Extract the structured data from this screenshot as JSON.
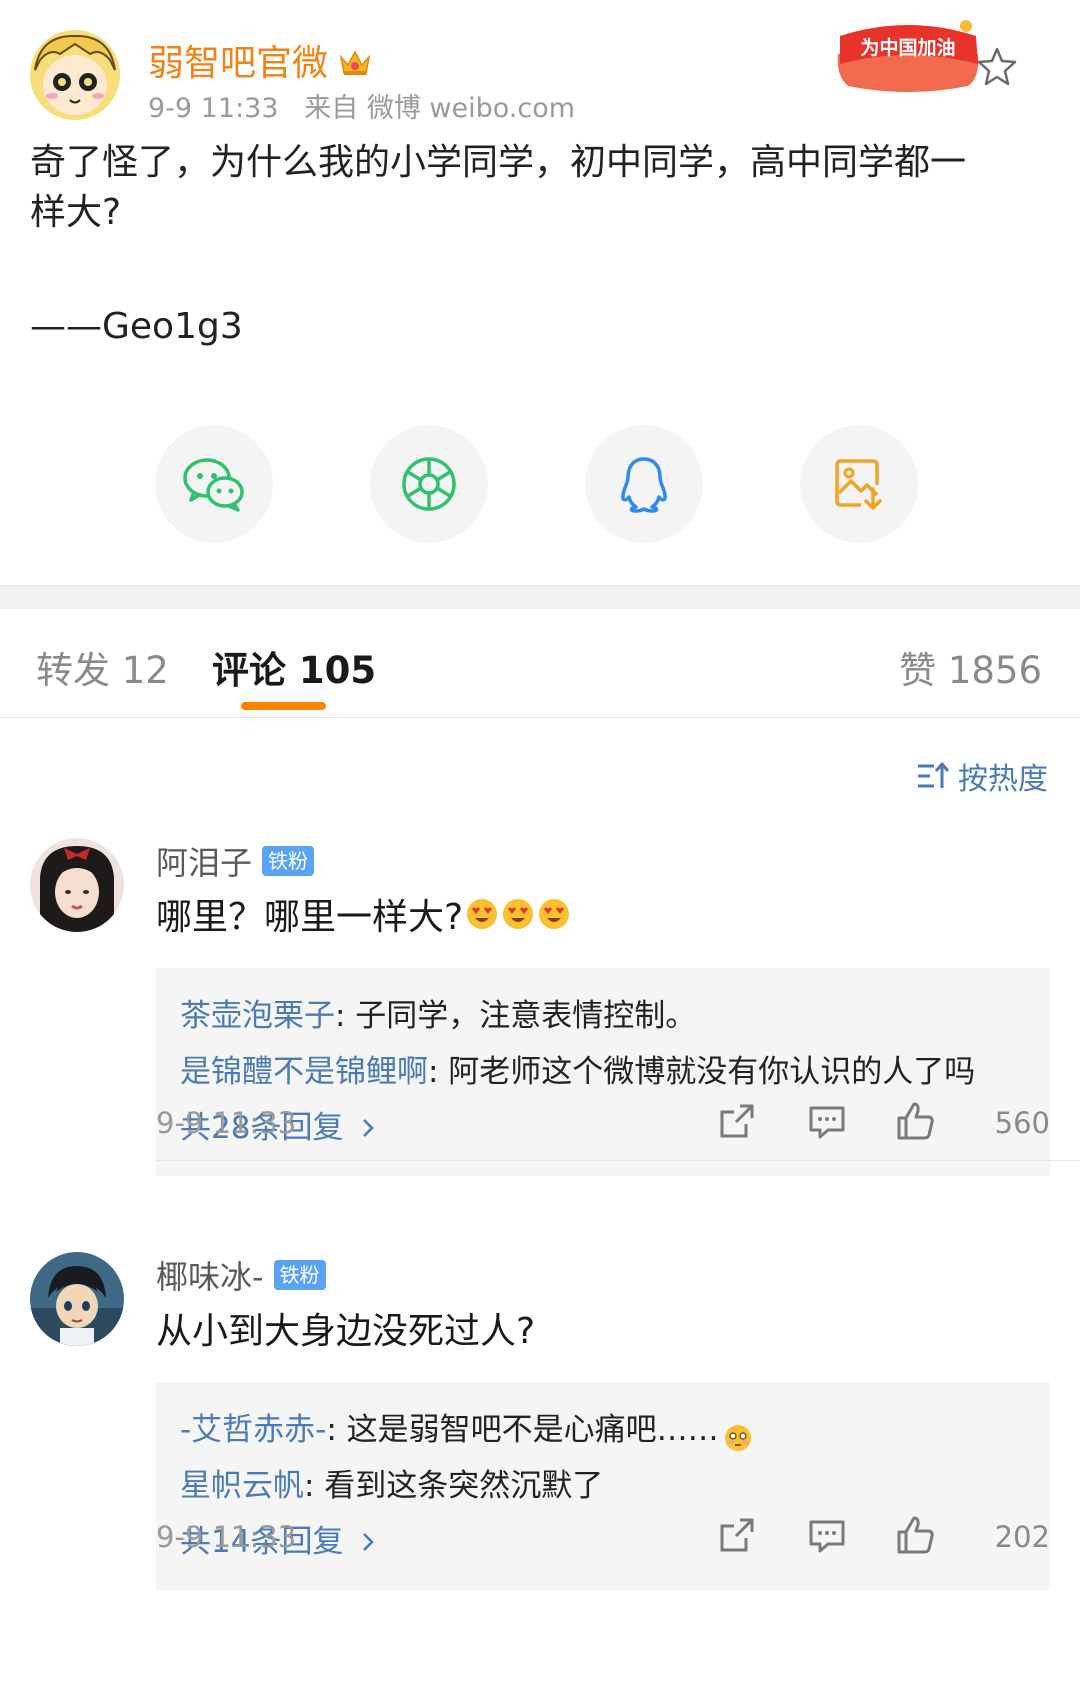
{
  "post": {
    "author": "弱智吧官微",
    "timestamp": "9-9 11:33",
    "source": "来自 微博 weibo.com",
    "badge_text": "为中国加油",
    "body": "奇了怪了，为什么我的小学同学，初中同学，高中同学都一\n样大?",
    "signature": "——Geo1g3"
  },
  "share": [
    {
      "icon": "wechat-icon",
      "color": "#2ec26a"
    },
    {
      "icon": "moments-icon",
      "color": "#2ec26a"
    },
    {
      "icon": "qq-icon",
      "color": "#2b8cf0"
    },
    {
      "icon": "save-image-icon",
      "color": "#f3a322"
    }
  ],
  "tabs": [
    {
      "label": "转发 12"
    },
    {
      "label": "评论 105"
    },
    {
      "label": "赞 1856"
    }
  ],
  "sort_label": "按热度",
  "comments": [
    {
      "user": "阿泪子",
      "badge": "铁粉",
      "text": "哪里？哪里一样大?",
      "emoji_count": 3,
      "replies": [
        {
          "user": "茶壶泡栗子",
          "text": ": 子同学，注意表情控制。"
        },
        {
          "user": "是锦醴不是锦鲤啊",
          "text": ": 阿老师这个微博就没有你认识的人了吗"
        }
      ],
      "more": "共28条回复",
      "time": "9-9 11:33",
      "likes": "560"
    },
    {
      "user": "椰味冰-",
      "badge": "铁粉",
      "text": "从小到大身边没死过人?",
      "emoji_count": 0,
      "replies": [
        {
          "user": "-艾哲赤赤-",
          "text": ": 这是弱智吧不是心痛吧……"
        },
        {
          "user": "星帜云帆",
          "text": ": 看到这条突然沉默了"
        }
      ],
      "more": "共14条回复",
      "time": "9-9 11:33",
      "likes": "202"
    }
  ],
  "colors": {
    "author": "#f08418",
    "link": "#4a7bb5",
    "accent": "#ff8200",
    "fan_badge": "#5aa2f4"
  }
}
